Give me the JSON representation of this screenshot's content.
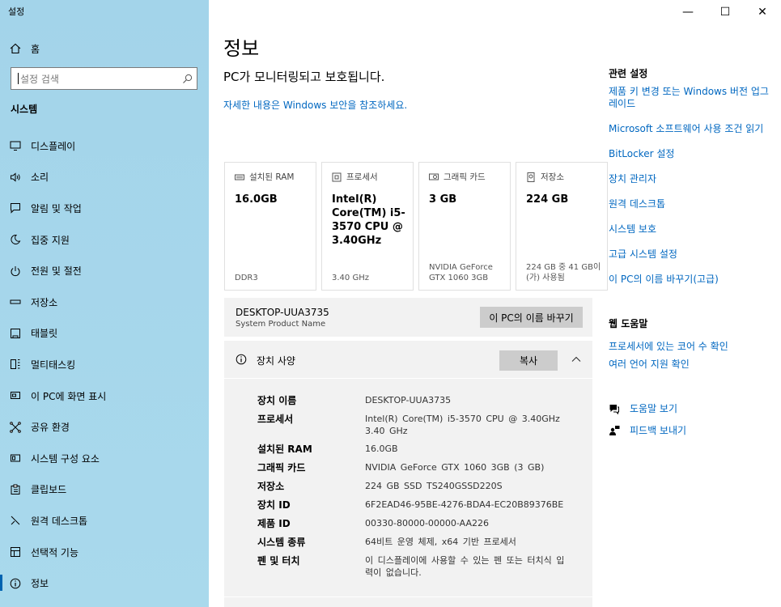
{
  "app": {
    "title": "설정"
  },
  "window_controls": {
    "minimize": "—",
    "maximize": "☐",
    "close": "✕"
  },
  "sidebar": {
    "home_label": "홈",
    "search_placeholder": "설정 검색",
    "section": "시스템",
    "items": [
      {
        "label": "디스플레이",
        "icon": "display-icon"
      },
      {
        "label": "소리",
        "icon": "speaker-icon"
      },
      {
        "label": "알림 및 작업",
        "icon": "notification-icon"
      },
      {
        "label": "집중 지원",
        "icon": "moon-icon"
      },
      {
        "label": "전원 및 절전",
        "icon": "power-icon"
      },
      {
        "label": "저장소",
        "icon": "storage-icon"
      },
      {
        "label": "태블릿",
        "icon": "tablet-icon"
      },
      {
        "label": "멀티태스킹",
        "icon": "multitasking-icon"
      },
      {
        "label": "이 PC에 화면 표시",
        "icon": "project-icon"
      },
      {
        "label": "공유 환경",
        "icon": "share-icon"
      },
      {
        "label": "시스템 구성 요소",
        "icon": "components-icon"
      },
      {
        "label": "클립보드",
        "icon": "clipboard-icon"
      },
      {
        "label": "원격 데스크톱",
        "icon": "remote-icon"
      },
      {
        "label": "선택적 기능",
        "icon": "optional-features-icon"
      },
      {
        "label": "정보",
        "icon": "info-icon",
        "active": true
      }
    ]
  },
  "main": {
    "title": "정보",
    "protect_text": "PC가 모니터링되고 보호됩니다.",
    "security_link": "자세한 내용은 Windows 보안을 참조하세요.",
    "cards": [
      {
        "label": "설치된 RAM",
        "value": "16.0GB",
        "sub": "DDR3",
        "icon": "ram-icon"
      },
      {
        "label": "프로세서",
        "value": "Intel(R) Core(TM) i5-3570 CPU @ 3.40GHz",
        "sub": "3.40 GHz",
        "icon": "cpu-icon"
      },
      {
        "label": "그래픽 카드",
        "value": "3 GB",
        "sub": "NVIDIA GeForce GTX 1060 3GB",
        "icon": "gpu-icon"
      },
      {
        "label": "저장소",
        "value": "224 GB",
        "sub": "224 GB 중 41 GB이(가) 사용됨",
        "icon": "storage-card-icon"
      }
    ],
    "device": {
      "name": "DESKTOP-UUA3735",
      "model": "System Product Name",
      "rename_button": "이 PC의 이름 바꾸기"
    },
    "specs": {
      "title": "장치 사양",
      "copy_button": "복사",
      "rows": [
        {
          "key": "장치 이름",
          "value": "DESKTOP-UUA3735"
        },
        {
          "key": "프로세서",
          "value": "Intel(R) Core(TM) i5-3570 CPU @ 3.40GHz 3.40 GHz"
        },
        {
          "key": "설치된 RAM",
          "value": "16.0GB"
        },
        {
          "key": "그래픽 카드",
          "value": "NVIDIA GeForce GTX 1060 3GB (3 GB)"
        },
        {
          "key": "저장소",
          "value": "224 GB SSD TS240GSSD220S"
        },
        {
          "key": "장치 ID",
          "value": "6F2EAD46-95BE-4276-BDA4-EC20B89376BE"
        },
        {
          "key": "제품 ID",
          "value": "00330-80000-00000-AA226"
        },
        {
          "key": "시스템 종류",
          "value": "64비트 운영 체제, x64 기반 프로세서"
        },
        {
          "key": "펜 및 터치",
          "value": "이 디스플레이에 사용할 수 있는 펜 또는 터치식 입력이 없습니다."
        }
      ]
    }
  },
  "related": {
    "title": "관련 설정",
    "links": [
      "제품 키 변경 또는 Windows 버전 업그레이드",
      "Microsoft 소프트웨어 사용 조건 읽기",
      "BitLocker 설정",
      "장치 관리자",
      "원격 데스크톱",
      "시스템 보호",
      "고급 시스템 설정",
      "이 PC의 이름 바꾸기(고급)"
    ]
  },
  "web_help": {
    "title": "웹 도움말",
    "links": [
      "프로세서에 있는 코어 수 확인",
      "여러 언어 지원 확인"
    ]
  },
  "support": {
    "help": "도움말 보기",
    "feedback": "피드백 보내기"
  },
  "colors": {
    "accent": "#0067c0",
    "sidebar": "#a8d8ea",
    "panel": "#f2f2f2"
  }
}
